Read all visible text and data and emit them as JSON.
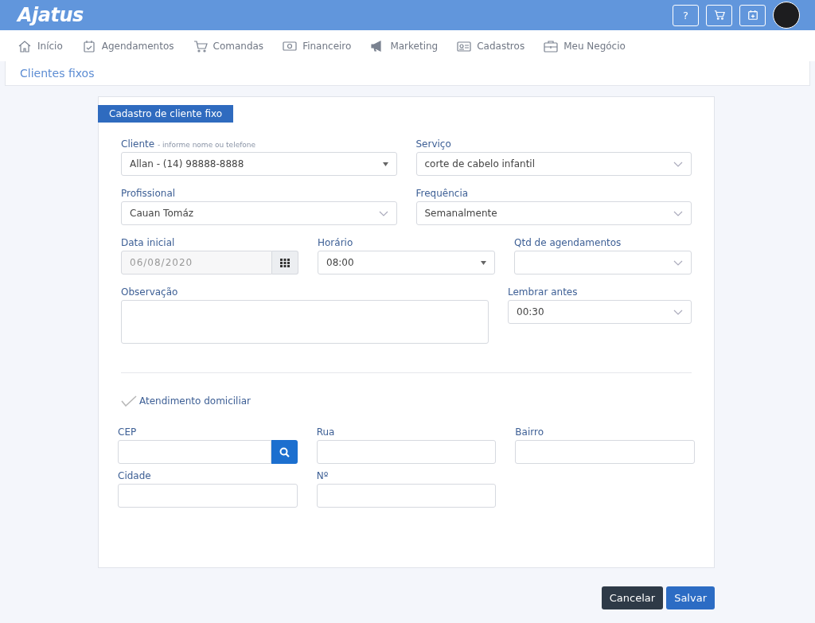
{
  "header": {
    "logo": "Ajatus",
    "actions": [
      {
        "kind": "help",
        "label": "?"
      },
      {
        "kind": "cart"
      },
      {
        "kind": "calendar"
      }
    ]
  },
  "nav": [
    {
      "kind": "home",
      "label": "Início"
    },
    {
      "kind": "calendar",
      "label": "Agendamentos"
    },
    {
      "kind": "cart",
      "label": "Comandas"
    },
    {
      "kind": "money",
      "label": "Financeiro"
    },
    {
      "kind": "megaphone",
      "label": "Marketing"
    },
    {
      "kind": "card",
      "label": "Cadastros"
    },
    {
      "kind": "briefcase",
      "label": "Meu Negócio"
    }
  ],
  "page_title": "Clientes fixos",
  "form": {
    "title": "Cadastro de cliente fixo",
    "rows": [
      [
        {
          "kind": "combo",
          "label": "Cliente",
          "hint": "- informe nome ou telefone",
          "value": "Allan - (14) 98888-8888"
        },
        {
          "kind": "select",
          "label": "Serviço",
          "value": "corte de cabelo infantil"
        }
      ],
      [
        {
          "kind": "select",
          "label": "Profissional",
          "value": "Cauan Tomáz"
        },
        {
          "kind": "select",
          "label": "Frequência",
          "value": "Semanalmente"
        }
      ],
      [
        {
          "kind": "date",
          "label": "Data inicial",
          "value": "06/08/2020"
        },
        {
          "kind": "combo",
          "label": "Horário",
          "value": "08:00"
        },
        {
          "kind": "select",
          "label": "Qtd de agendamentos"
        }
      ],
      [
        {
          "kind": "textarea",
          "label": "Observação"
        },
        {
          "kind": "select",
          "label": "Lembrar antes",
          "value": "00:30"
        }
      ]
    ],
    "home_service": {
      "label": "Atendimento domiciliar",
      "checked": false
    },
    "address": [
      {
        "kind": "search",
        "label": "CEP"
      },
      {
        "kind": "text",
        "label": "Rua"
      },
      {
        "kind": "text",
        "label": "Bairro"
      },
      {
        "kind": "text",
        "label": "Cidade"
      },
      {
        "kind": "text",
        "label": "Nº"
      }
    ]
  },
  "buttons": [
    {
      "kind": "secondary",
      "label": "Cancelar"
    },
    {
      "kind": "primary",
      "label": "Salvar"
    }
  ]
}
